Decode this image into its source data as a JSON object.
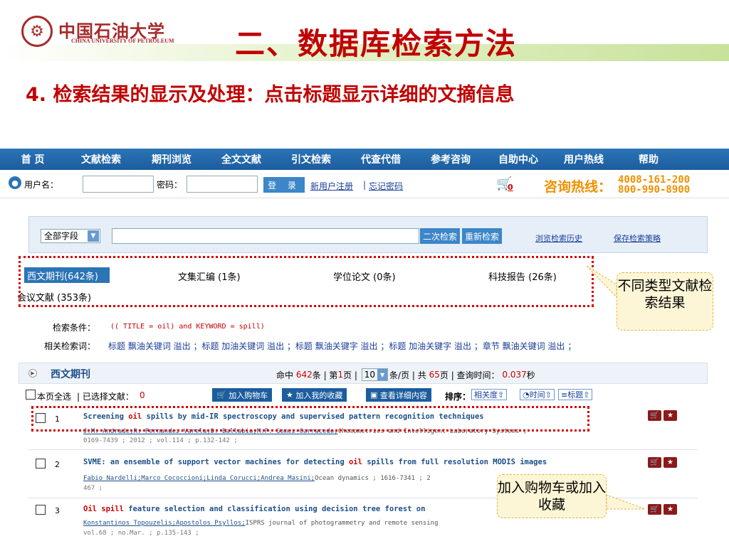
{
  "slide": {
    "logo_glyph": "⚙",
    "university_cn": "中国石油大学",
    "university_en": "CHINA UNIVERSITY OF PETROLEUM",
    "title": "二、数据库检索方法",
    "subtitle": "4. 检索结果的显示及处理：点击标题显示详细的文摘信息"
  },
  "nav": [
    "首 页",
    "文献检索",
    "期刊浏览",
    "全文文献",
    "引文检索",
    "代查代借",
    "参考咨询",
    "自助中心",
    "用户热线",
    "帮助"
  ],
  "login": {
    "username_label": "用户名：",
    "password_label": "密码：",
    "login_button": "登 录",
    "register_link": "新用户注册",
    "separator": "|",
    "forgot_link": "忘记密码",
    "cart_count": "0",
    "hotline_label": "咨询热线：",
    "hotline_1": "4008-161-200",
    "hotline_2": "800-990-8900"
  },
  "search": {
    "field_select": "全部字段",
    "keyword_value": "",
    "secondary_search": "二次检索",
    "new_search": "重新检索",
    "history_link": "浏览检索历史",
    "save_link": "保存检索策略"
  },
  "categories": [
    {
      "label": "西文期刊(642条)",
      "active": true
    },
    {
      "label": "文集汇编 (1条)"
    },
    {
      "label": "学位论文 (0条)"
    },
    {
      "label": "科技报告 (26条)"
    },
    {
      "label": "会议文献 (353条)"
    }
  ],
  "callouts": {
    "types": "不同类型文献检索结果",
    "cart": "加入购物车或加入收藏"
  },
  "condition": {
    "label": "检索条件：",
    "value": "(( TITLE = oil) and KEYWORD = spill)",
    "related_label": "相关检索词：",
    "related": "标题 飘油关键词 溢出 ；标题 加油关键词 溢出 ；标题 飘油关键字 溢出 ；标题 加油关键字 溢出 ；章节 飘油关键词 溢出 ；"
  },
  "results": {
    "section_title": "西文期刊",
    "hit_prefix": "命中",
    "hits": "642",
    "hit_suffix": "条 | 第",
    "page": "1",
    "page_suffix": "页 |",
    "per_page": "10",
    "per_page_suffix": "条/页 | 共",
    "total_pages": "65",
    "time_prefix": "页 | 查询时间：",
    "time": "0.037",
    "time_suffix": "秒",
    "select_all": "本页全选",
    "selected_prefix": "| 已选择文献：",
    "selected_count": "0",
    "add_cart": "加入购物车",
    "add_fav": "加入我的收藏",
    "view_detail": "查看详细内容",
    "sort_label": "排序：",
    "sort_relevance": "相关度",
    "sort_time": "时间",
    "sort_title": "标题"
  },
  "articles": [
    {
      "num": "1",
      "title_pre": "Screening ",
      "title_kw": "oil",
      "title_post": " spills by mid-IR spectroscopy and supervised pattern recognition techniques",
      "authors": "J.M. Andrade;R. Fernandez-Varela;D. Ballabio;M.P. Gomez-Carracedo;",
      "source": "Chemometrics and Intelligent Laboratory Systems ;",
      "line2": "0169-7439 ; 2012 ; vol.114 ; p.132-142 ;"
    },
    {
      "num": "2",
      "title_pre": "SVME: an ensemble of support vector machines for detecting ",
      "title_kw": "oil",
      "title_post": " spills from full resolution MODIS images",
      "authors": "Fabio Nardelli;Marco Cococcioni;Linda Corucci;Andrea Masini;",
      "source": "Ocean dynamics ; 1616-7341 ; 2",
      "line2": "467 ;"
    },
    {
      "num": "3",
      "title_pre": "",
      "title_kw": "Oil spill",
      "title_post": " feature selection and classification using decision tree forest on",
      "authors": "Konstantinos Topouzelis;Apostolos Psyllos;",
      "source": "ISPRS journal of photogrammetry and remote sensing",
      "line2": "vol.68 ; no.Mar. ; p.135-143 ;"
    }
  ]
}
